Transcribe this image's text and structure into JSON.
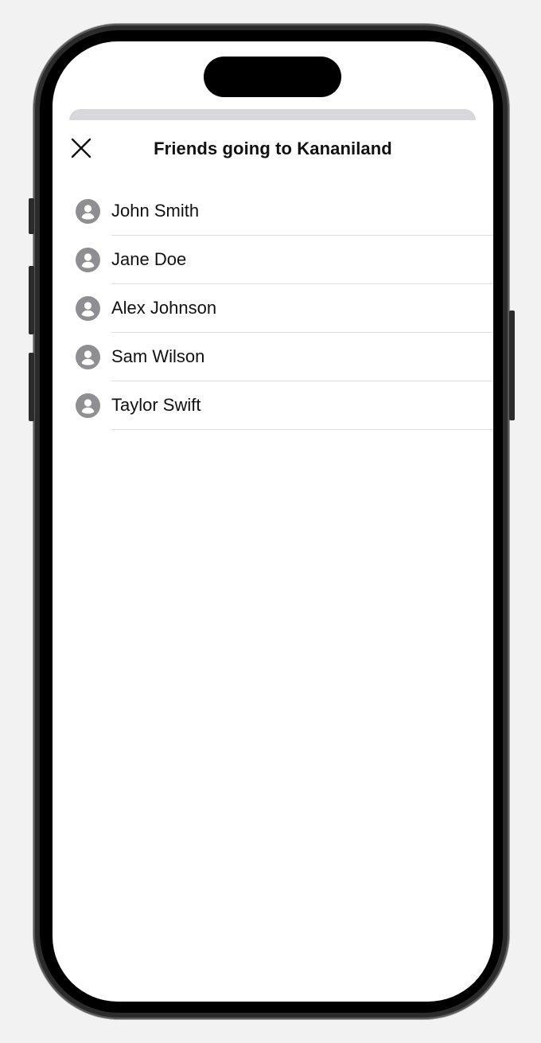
{
  "sheet": {
    "title": "Friends going to Kananiland",
    "close_icon": "close-icon"
  },
  "friends": [
    {
      "name": "John Smith",
      "icon": "person-circle-icon"
    },
    {
      "name": "Jane Doe",
      "icon": "person-circle-icon"
    },
    {
      "name": "Alex Johnson",
      "icon": "person-circle-icon"
    },
    {
      "name": "Sam Wilson",
      "icon": "person-circle-icon"
    },
    {
      "name": "Taylor Swift",
      "icon": "person-circle-icon"
    }
  ],
  "colors": {
    "avatar": "#8e8e93",
    "separator": "#dedede",
    "text": "#111111",
    "background": "#ffffff"
  }
}
